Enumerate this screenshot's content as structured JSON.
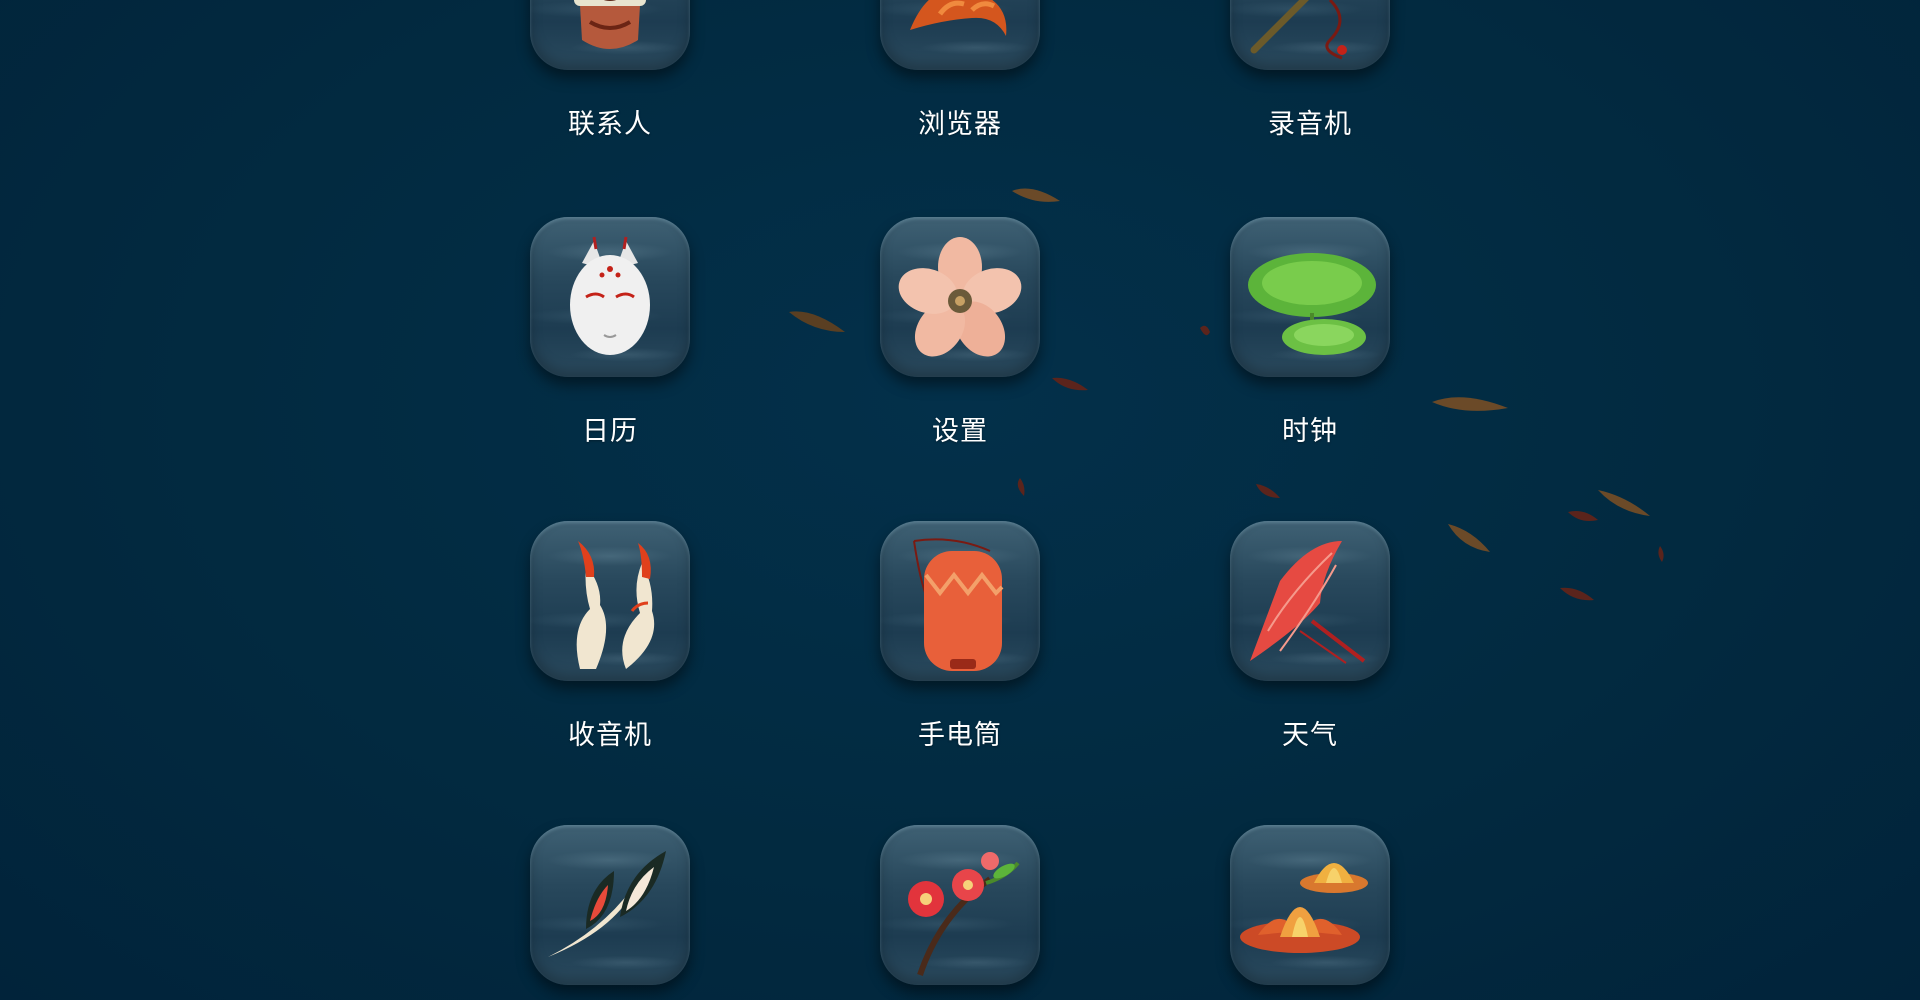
{
  "theme": {
    "background": "#02283e",
    "tile": "#28485c",
    "label_color": "#ffffff"
  },
  "apps": [
    {
      "label": "联系人",
      "icon": "demon-mask-icon"
    },
    {
      "label": "浏览器",
      "icon": "koi-fish-icon"
    },
    {
      "label": "录音机",
      "icon": "flute-icon"
    },
    {
      "label": "日历",
      "icon": "fox-mask-icon"
    },
    {
      "label": "设置",
      "icon": "flower-icon"
    },
    {
      "label": "时钟",
      "icon": "lotus-leaf-icon"
    },
    {
      "label": "收音机",
      "icon": "flame-icon"
    },
    {
      "label": "手电筒",
      "icon": "lantern-icon"
    },
    {
      "label": "天气",
      "icon": "umbrella-icon"
    },
    {
      "label": "",
      "icon": "feather-icon"
    },
    {
      "label": "",
      "icon": "plum-blossom-icon"
    },
    {
      "label": "",
      "icon": "lotus-flower-icon"
    }
  ]
}
